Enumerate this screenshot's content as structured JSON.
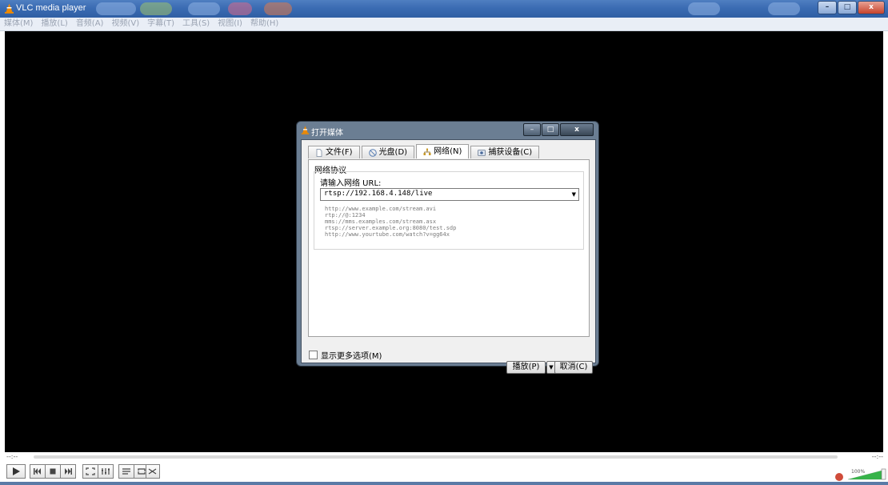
{
  "window": {
    "title": "VLC media player",
    "minimize_label": "–",
    "maximize_label": "□",
    "close_label": "x"
  },
  "menu": [
    "媒体(M)",
    "播放(L)",
    "音频(A)",
    "视频(V)",
    "字幕(T)",
    "工具(S)",
    "视图(I)",
    "帮助(H)"
  ],
  "dialog": {
    "title": "打开媒体",
    "minimize_label": "–",
    "maximize_label": "□",
    "close_label": "x",
    "tabs": [
      {
        "label": "文件(F)",
        "icon": "file-icon"
      },
      {
        "label": "光盘(D)",
        "icon": "disc-icon"
      },
      {
        "label": "网络(N)",
        "icon": "network-icon",
        "active": true
      },
      {
        "label": "捕获设备(C)",
        "icon": "capture-device-icon"
      }
    ],
    "group_label": "网络协议",
    "url_label": "请输入网络 URL:",
    "url_value": "rtsp://192.168.4.148/live",
    "examples": [
      "http://www.example.com/stream.avi",
      "rtp://@:1234",
      "mms://mms.examples.com/stream.asx",
      "rtsp://server.example.org:8080/test.sdp",
      "http://www.yourtube.com/watch?v=gg64x"
    ],
    "more_options_label": "显示更多选项(M)",
    "play_label": "播放(P)",
    "cancel_label": "取消(C)"
  },
  "controls": {
    "time_elapsed": "--:--",
    "time_remaining": "--:--",
    "volume_percent": "100%",
    "volume_level": 1.0,
    "progress": 0
  },
  "colors": {
    "titlebar": "#3b6cb3",
    "video_bg": "#000000",
    "dialog_frame": "#6b7e93"
  }
}
